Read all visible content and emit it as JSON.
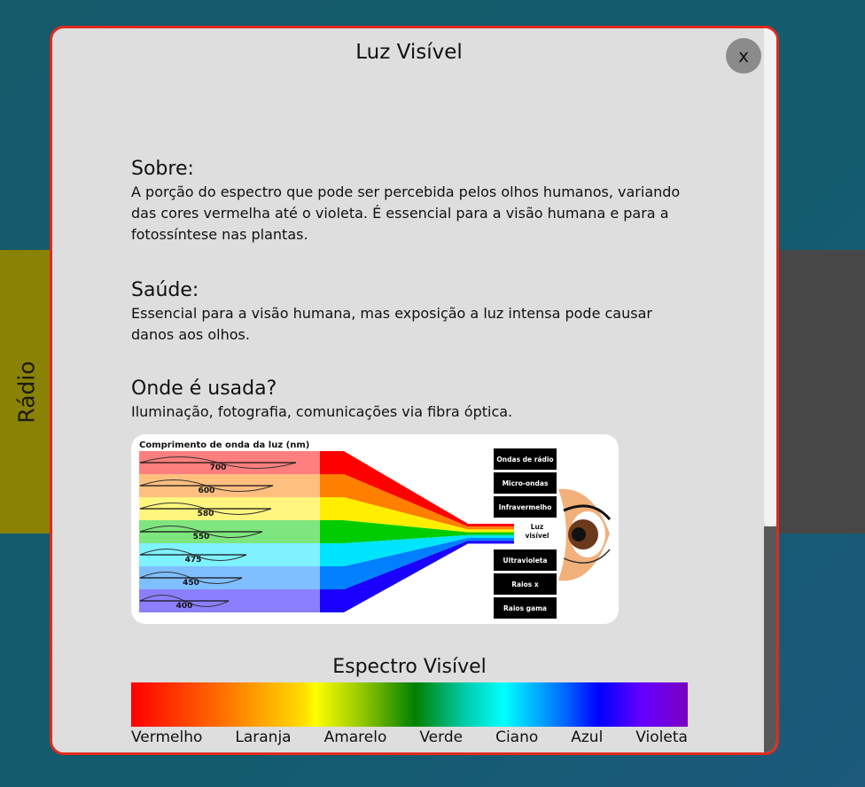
{
  "background": {
    "left_card_label": "Rádio",
    "left_card_color": "#8a8205",
    "right_card_color": "#474747"
  },
  "modal": {
    "title": "Luz Visível",
    "close_label": "x",
    "border_color": "#e02a1d",
    "sections": {
      "about": {
        "heading": "Sobre:",
        "text": "A porção do espectro que pode ser percebida pelos olhos humanos, variando das cores vermelha até o violeta. É essencial para a visão humana e para a fotossíntese nas plantas."
      },
      "health": {
        "heading": "Saúde:",
        "text": "Essencial para a visão humana, mas exposição a luz intensa pode causar danos aos olhos."
      },
      "uses": {
        "heading": "Onde é usada?",
        "text": "Iluminação, fotografia, comunicações via fibra óptica."
      }
    },
    "diagram": {
      "title": "Comprimento de onda da luz (nm)",
      "wavelengths": [
        "700",
        "600",
        "580",
        "550",
        "475",
        "450",
        "400"
      ],
      "band_colors": [
        "#ff0000",
        "#ff7f00",
        "#ffee00",
        "#00cc00",
        "#00e5ff",
        "#0080ff",
        "#1a00ff"
      ],
      "spectrum_boxes": [
        "Ondas de rádio",
        "Micro-ondas",
        "Infravermelho",
        "Luz\nvisível",
        "Ultravioleta",
        "Raios x",
        "Raios gama"
      ],
      "visible_label_line1": "Luz",
      "visible_label_line2": "visível"
    },
    "spectrum": {
      "title": "Espectro Visível",
      "labels": [
        "Vermelho",
        "Laranja",
        "Amarelo",
        "Verde",
        "Ciano",
        "Azul",
        "Violeta"
      ]
    }
  }
}
